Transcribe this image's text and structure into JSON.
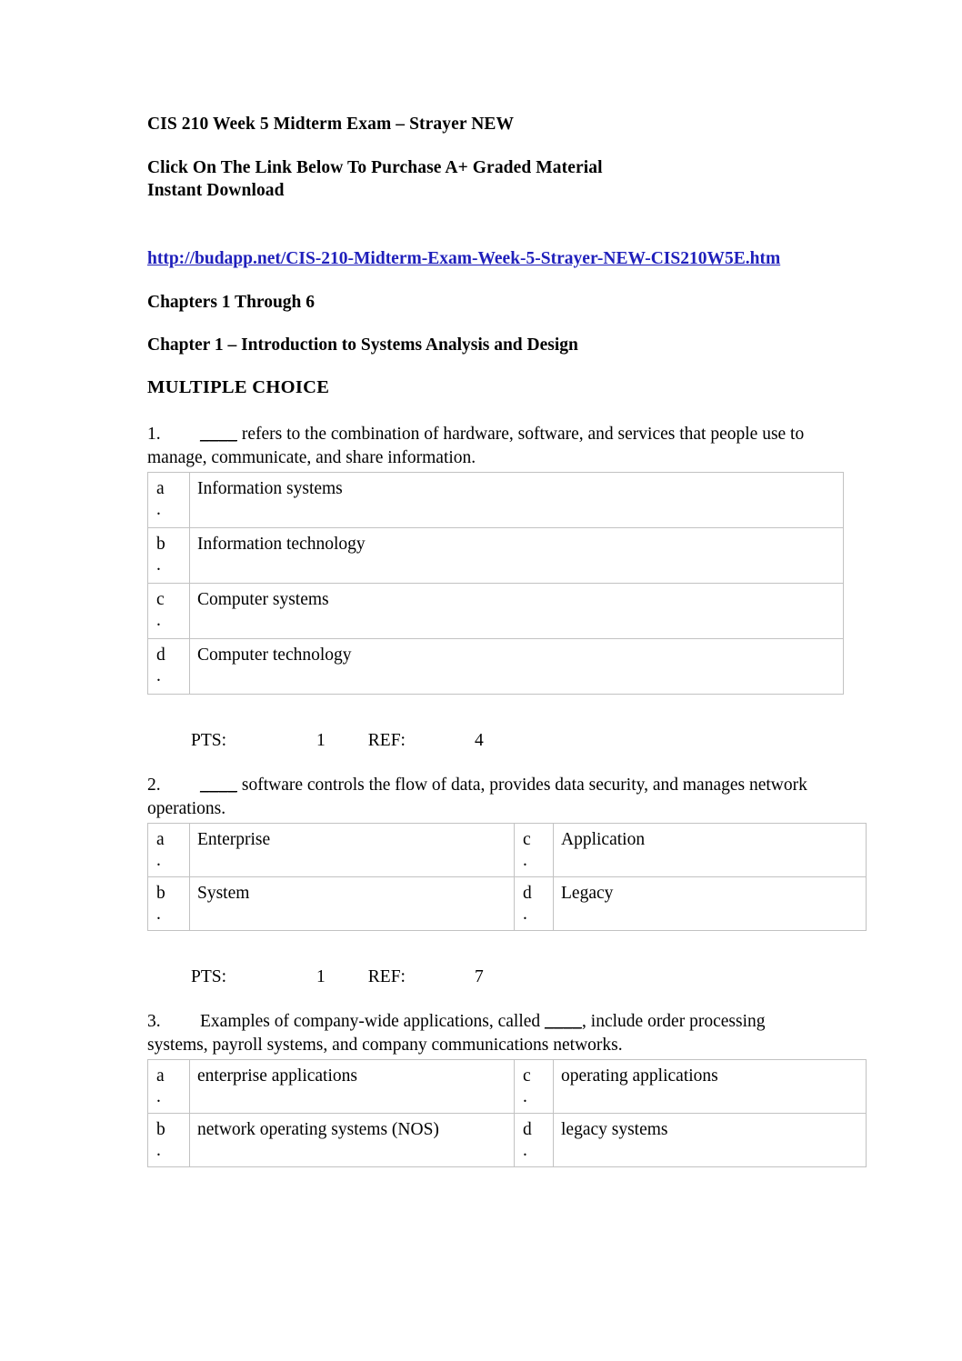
{
  "document": {
    "title": "CIS 210 Week 5 Midterm Exam – Strayer NEW",
    "purchase_line_1": "Click On The Link Below To Purchase A+ Graded Material",
    "purchase_line_2": "Instant Download",
    "link_text": "http://budapp.net/CIS-210-Midterm-Exam-Week-5-Strayer-NEW-CIS210W5E.htm",
    "link_color": "#1f1fbb",
    "chapters_range": "Chapters 1 Through 6",
    "chapter_heading": "Chapter 1 – Introduction to Systems Analysis and Design",
    "section_heading": "MULTIPLE CHOICE"
  },
  "labels": {
    "pts": "PTS:",
    "ref": "REF:",
    "blank": "____",
    "dot": "."
  },
  "questions": [
    {
      "number": "1.",
      "text_before_blank": "",
      "text_after_blank": " refers to the combination of hardware, software, and services that people use to manage, communicate, and share information.",
      "layout": "single",
      "options": [
        {
          "letter": "a",
          "text": "Information systems"
        },
        {
          "letter": "b",
          "text": "Information technology"
        },
        {
          "letter": "c",
          "text": "Computer systems"
        },
        {
          "letter": "d",
          "text": "Computer technology"
        }
      ],
      "pts_value": "1",
      "ref_value": "4"
    },
    {
      "number": "2.",
      "text_before_blank": "",
      "text_after_blank": " software controls the flow of data, provides data security, and manages network operations.",
      "layout": "paired",
      "options": [
        {
          "letter": "a",
          "text": "Enterprise"
        },
        {
          "letter": "c",
          "text": "Application"
        },
        {
          "letter": "b",
          "text": "System"
        },
        {
          "letter": "d",
          "text": "Legacy"
        }
      ],
      "pts_value": "1",
      "ref_value": "7"
    },
    {
      "number": "3.",
      "text_before_blank": "Examples of company-wide applications, called ",
      "text_after_blank": ", include order processing systems, payroll systems, and company communications networks.",
      "layout": "paired",
      "options": [
        {
          "letter": "a",
          "text": "enterprise applications"
        },
        {
          "letter": "c",
          "text": "operating applications"
        },
        {
          "letter": "b",
          "text": "network operating systems (NOS)"
        },
        {
          "letter": "d",
          "text": "legacy systems"
        }
      ],
      "pts_value": null,
      "ref_value": null
    }
  ]
}
